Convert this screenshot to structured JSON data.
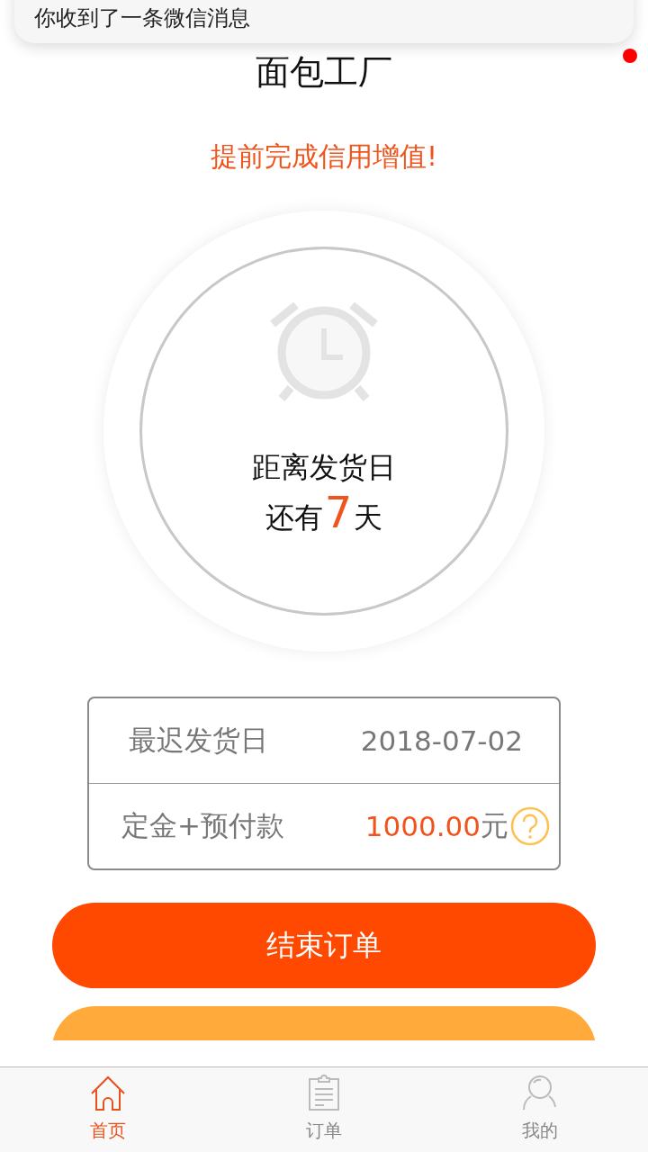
{
  "notification": {
    "text": "你收到了一条微信消息"
  },
  "header": {
    "title": "面包工厂"
  },
  "subtitle": "提前完成信用增值!",
  "countdown": {
    "label": "距离发货日",
    "prefix": "还有",
    "number": "7",
    "suffix": "天"
  },
  "details": [
    {
      "kind": "date",
      "label": "最迟发货日",
      "value": "2018-07-02"
    },
    {
      "kind": "amount",
      "label": "定金+预付款",
      "value": "1000.00",
      "unit": "元"
    }
  ],
  "buttons": [
    {
      "kind": "primary",
      "label": "结束订单"
    },
    {
      "kind": "secondary"
    }
  ],
  "tabs": [
    {
      "kind": "home",
      "label": "首页",
      "selected": true
    },
    {
      "kind": "orders",
      "label": "订单",
      "selected": false
    },
    {
      "kind": "profile",
      "label": "我的",
      "selected": false
    }
  ]
}
